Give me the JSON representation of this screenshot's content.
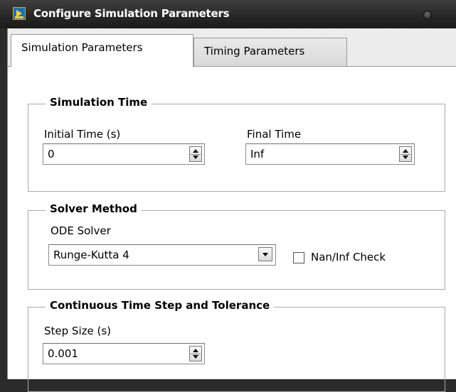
{
  "window": {
    "title": "Configure Simulation Parameters",
    "app_icon": "labview-vi-icon",
    "control_icon": "window-control-circle-icon"
  },
  "tabs": [
    {
      "label": "Simulation Parameters",
      "active": true
    },
    {
      "label": "Timing Parameters",
      "active": false
    }
  ],
  "simulation_time": {
    "legend": "Simulation Time",
    "initial_time_label": "Initial Time (s)",
    "initial_time_value": "0",
    "final_time_label": "Final Time",
    "final_time_value": "Inf"
  },
  "solver_method": {
    "legend": "Solver Method",
    "ode_solver_label": "ODE Solver",
    "ode_solver_value": "Runge-Kutta 4",
    "nan_inf_check_label": "Nan/Inf Check",
    "nan_inf_check_checked": false
  },
  "continuous": {
    "legend": "Continuous Time Step and Tolerance",
    "step_size_label": "Step Size (s)",
    "step_size_value": "0.001"
  },
  "colors": {
    "titlebar": "#262626",
    "panel": "#ffffff",
    "tabstrip": "#ececec"
  }
}
